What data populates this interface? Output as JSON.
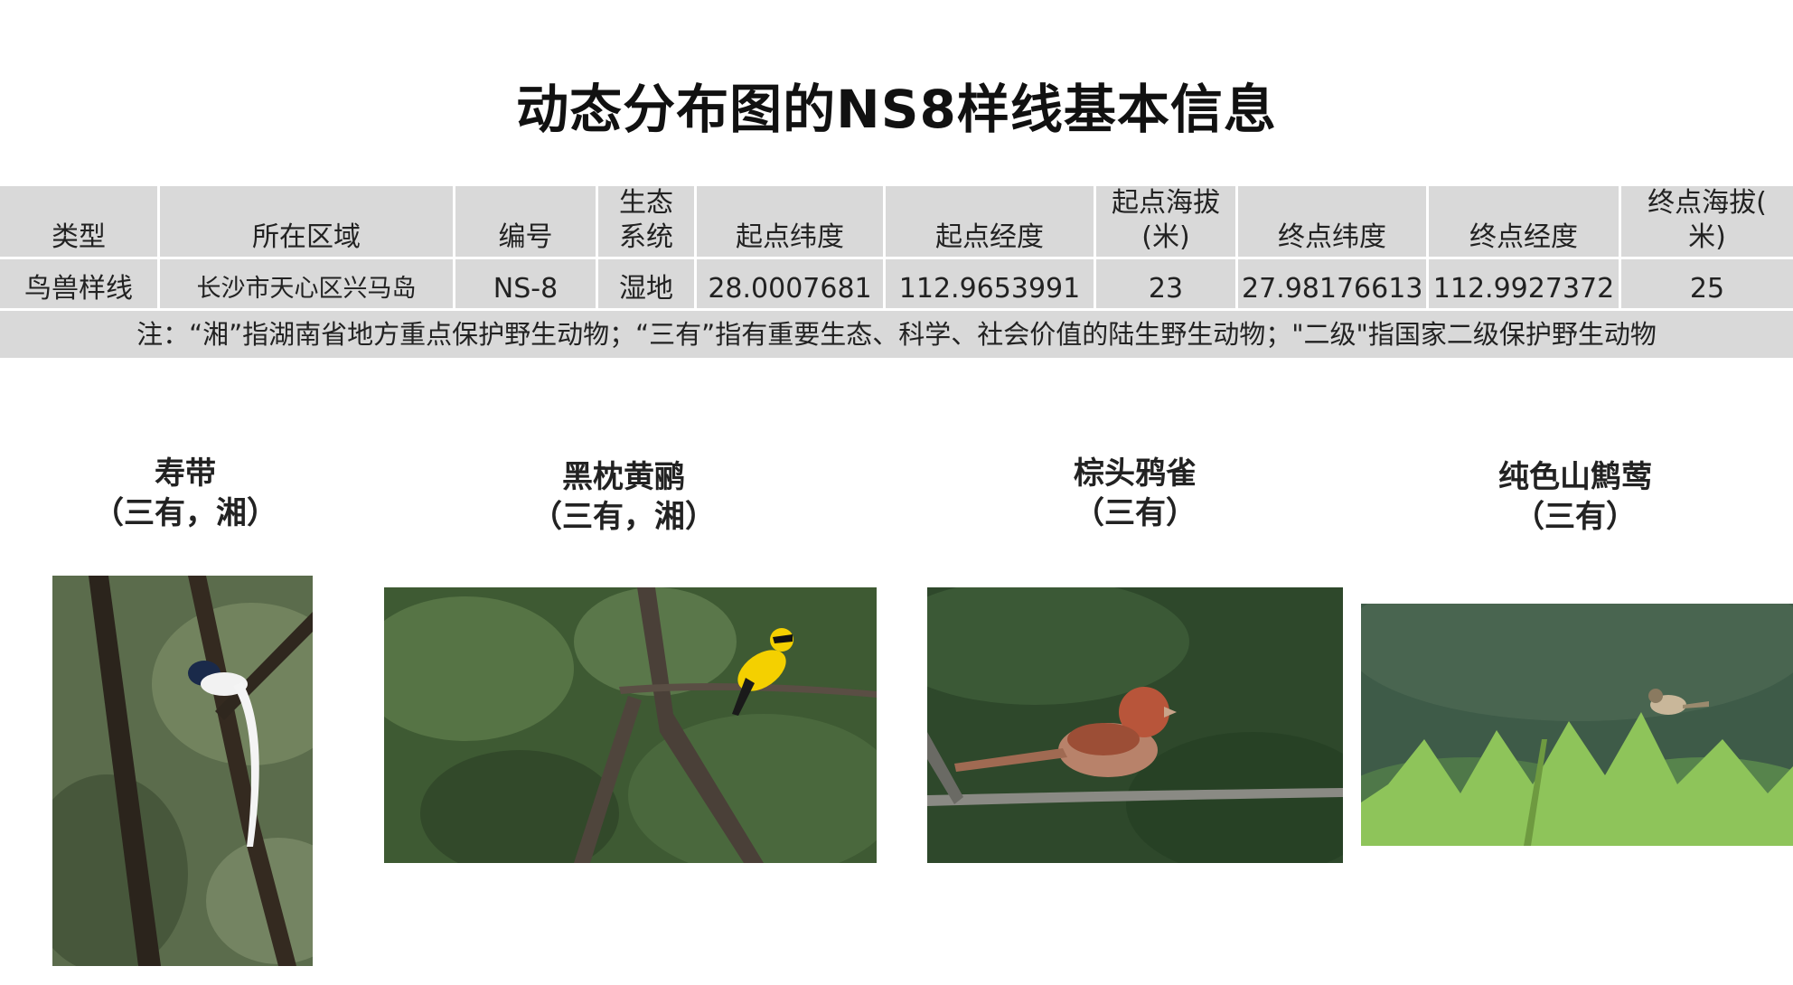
{
  "title": "动态分布图的NS8样线基本信息",
  "table": {
    "headers": [
      "类型",
      "所在区域",
      "编号",
      "生态系统",
      "起点纬度",
      "起点经度",
      "起点海拔(米)",
      "终点纬度",
      "终点经度",
      "终点海拔(米)"
    ],
    "header_lines": [
      [
        "类型"
      ],
      [
        "所在区域"
      ],
      [
        "编号"
      ],
      [
        "生态",
        "系统"
      ],
      [
        "起点纬度"
      ],
      [
        "起点经度"
      ],
      [
        "起点海拔",
        "(米)"
      ],
      [
        "终点纬度"
      ],
      [
        "终点经度"
      ],
      [
        "终点海拔(",
        "米)"
      ]
    ],
    "row": [
      "鸟兽样线",
      "长沙市天心区兴马岛",
      "NS-8",
      "湿地",
      "28.0007681",
      "112.9653991",
      "23",
      "27.98176613",
      "112.9927372",
      "25"
    ],
    "note": "注：“湘”指湖南省地方重点保护野生动物；“三有”指有重要生态、科学、社会价值的陆生野生动物；\"二级\"指国家二级保护野生动物"
  },
  "birds": [
    {
      "name": "寿带",
      "status": "（三有，湘）",
      "photo_icon": "paradise-flycatcher-photo",
      "colors": {
        "bg": "#5a6e4a",
        "body": "#f2f2f2",
        "head": "#1a2a4a"
      }
    },
    {
      "name": "黑枕黄鹂",
      "status": "（三有，湘）",
      "photo_icon": "black-naped-oriole-photo",
      "colors": {
        "bg": "#3f5a33",
        "body": "#f4d000",
        "head": "#111111"
      }
    },
    {
      "name": "棕头鸦雀",
      "status": "（三有）",
      "photo_icon": "vinous-throated-parrotbill-photo",
      "colors": {
        "bg": "#2f4a2c",
        "body": "#b8826a",
        "head": "#b8553a"
      }
    },
    {
      "name": "纯色山鹪莺",
      "status": "（三有）",
      "photo_icon": "plain-prinia-photo",
      "colors": {
        "bg": "#3d5a48",
        "body": "#c9b79a",
        "head": "#8a7a60"
      }
    }
  ]
}
